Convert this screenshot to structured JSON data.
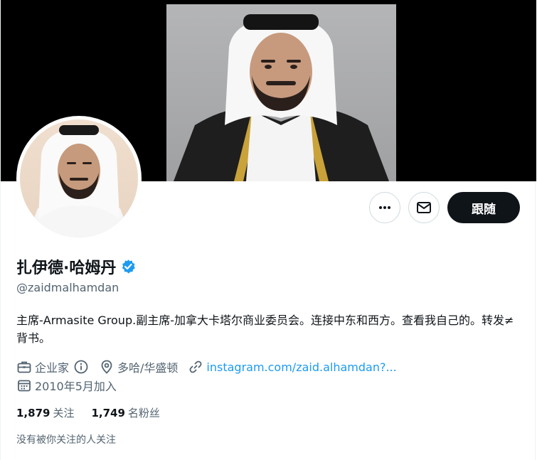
{
  "profile": {
    "name": "扎伊德·哈姆丹",
    "handle": "@zaidmalhamdan",
    "bio": "主席-Armasite Group.副主席-加拿大卡塔尔商业委员会。连接中东和西方。查看我自己的。转发≠背书。",
    "category": "企业家",
    "location": "多哈/华盛顿",
    "link": "instagram.com/zaid.alhamdan?...",
    "joined": "2010年5月加入"
  },
  "actions": {
    "follow_label": "跟随"
  },
  "stats": {
    "following_count": "1,879",
    "following_label": "关注",
    "followers_count": "1,749",
    "followers_label": "名粉丝"
  },
  "followers_note": "没有被你关注的人关注",
  "colors": {
    "accent": "#1d9bf0",
    "text": "#0f1419",
    "secondary": "#536471",
    "button_dark": "#0f1419"
  }
}
